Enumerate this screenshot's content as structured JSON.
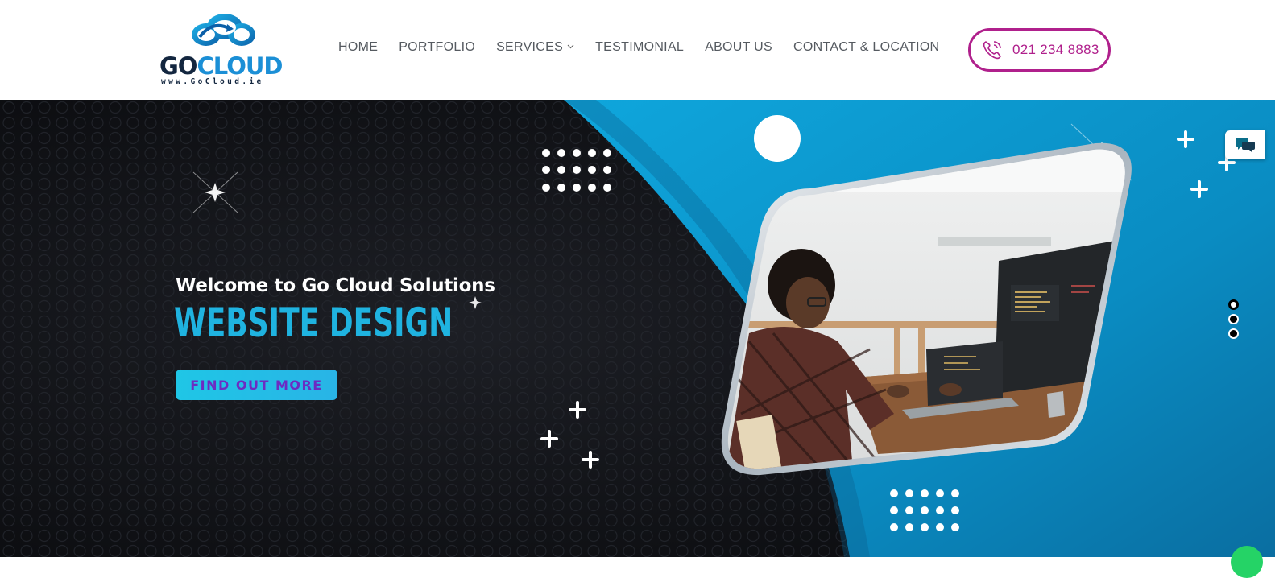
{
  "brand": {
    "logo_main": "GO",
    "logo_accent": "CLOUD",
    "logo_url": "www.GoCloud.ie"
  },
  "nav": {
    "items": [
      {
        "label": "HOME"
      },
      {
        "label": "PORTFOLIO"
      },
      {
        "label": "SERVICES",
        "has_dropdown": true
      },
      {
        "label": "TESTIMONIAL"
      },
      {
        "label": "ABOUT US"
      },
      {
        "label": "CONTACT & LOCATION"
      }
    ]
  },
  "phone": {
    "number": "021 234 8883",
    "icon": "phone-icon",
    "color": "#b0208c"
  },
  "hero": {
    "welcome": "Welcome to Go Cloud Solutions",
    "headline": "WEBSITE DESIGN",
    "cta_label": "FIND OUT MORE",
    "slides_count": 3,
    "active_slide": 1,
    "colors": {
      "dark_bg": "#0d0e12",
      "blue_bg": "#0a8fc4",
      "headline": "#1fb3e0",
      "cta_text": "#6d2bc2"
    }
  },
  "widgets": {
    "chat_icon": "chat-bubbles-icon",
    "whatsapp_icon": "whatsapp-icon"
  }
}
